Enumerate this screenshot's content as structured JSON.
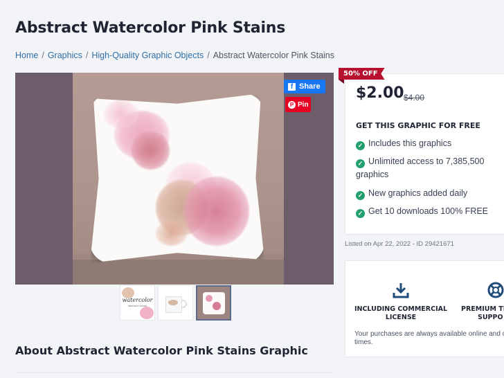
{
  "page": {
    "title": "Abstract Watercolor Pink Stains",
    "about_heading": "About Abstract Watercolor Pink Stains Graphic"
  },
  "breadcrumb": {
    "items": [
      "Home",
      "Graphics",
      "High-Quality Graphic Objects"
    ],
    "current": "Abstract Watercolor Pink Stains",
    "separator": "/"
  },
  "share": {
    "facebook_label": "Share",
    "facebook_icon": "f",
    "pinterest_label": "Pin",
    "pinterest_icon": "P"
  },
  "thumbnails": {
    "items": [
      {
        "label": "watercolor",
        "sub": "ABSTRACT STAINS"
      },
      {
        "label": "mug"
      },
      {
        "label": "pillow"
      }
    ],
    "active_index": 2
  },
  "pricing": {
    "badge": "50% OFF",
    "price": "$2.00",
    "old_price": "$4.00",
    "free_heading": "GET THIS GRAPHIC FOR FREE",
    "features": [
      "Includes this graphics",
      "Unlimited access to 7,385,500 graphics",
      "New graphics added daily",
      "Get 10 downloads 100% FREE"
    ],
    "check_icon": "✓"
  },
  "listing": {
    "listed_text": "Listed on Apr 22, 2022 - ID 29421671"
  },
  "license": {
    "commercial_label_1": "INCLUDING COMMERCIAL",
    "commercial_label_2": "LICENSE",
    "support_label_1": "PREMIUM TEC",
    "support_label_2": "SUPPO",
    "note": "Your purchases are always available online and of times."
  },
  "colors": {
    "accent_blue": "#2f6ea5",
    "badge_red": "#b8102f",
    "check_green": "#22a06b",
    "facebook": "#1877f2",
    "pinterest": "#e60023"
  }
}
